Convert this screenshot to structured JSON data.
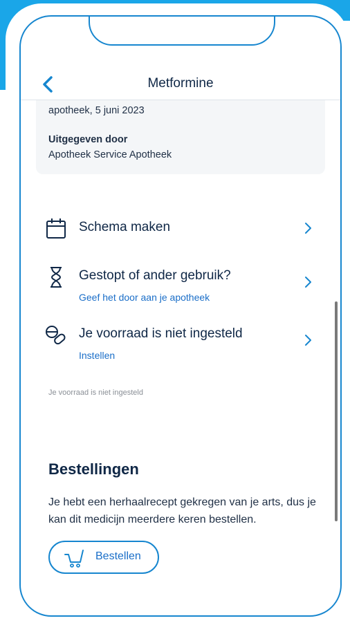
{
  "header": {
    "title": "Metformine"
  },
  "info": {
    "date_line": "apotheek, 5 juni 2023",
    "issued_label": "Uitgegeven door",
    "issued_value": "Apotheek Service Apotheek"
  },
  "rows": [
    {
      "icon": "calendar-icon",
      "title": "Schema maken",
      "subtitle": ""
    },
    {
      "icon": "hourglass-icon",
      "title": "Gestopt of ander gebruik?",
      "subtitle": "Geef het door aan je apotheek"
    },
    {
      "icon": "pills-icon",
      "title": "Je voorraad is niet ingesteld",
      "subtitle": "Instellen"
    }
  ],
  "note": "Je voorraad is niet ingesteld",
  "orders": {
    "title": "Bestellingen",
    "text": "Je hebt een herhaalrecept gekregen van je arts, dus je kan dit medicijn meerdere keren bestellen.",
    "button": "Bestellen"
  },
  "colors": {
    "accent": "#1686cf",
    "text": "#0f2746",
    "link": "#1a6ec8",
    "card": "#f4f6f8"
  }
}
